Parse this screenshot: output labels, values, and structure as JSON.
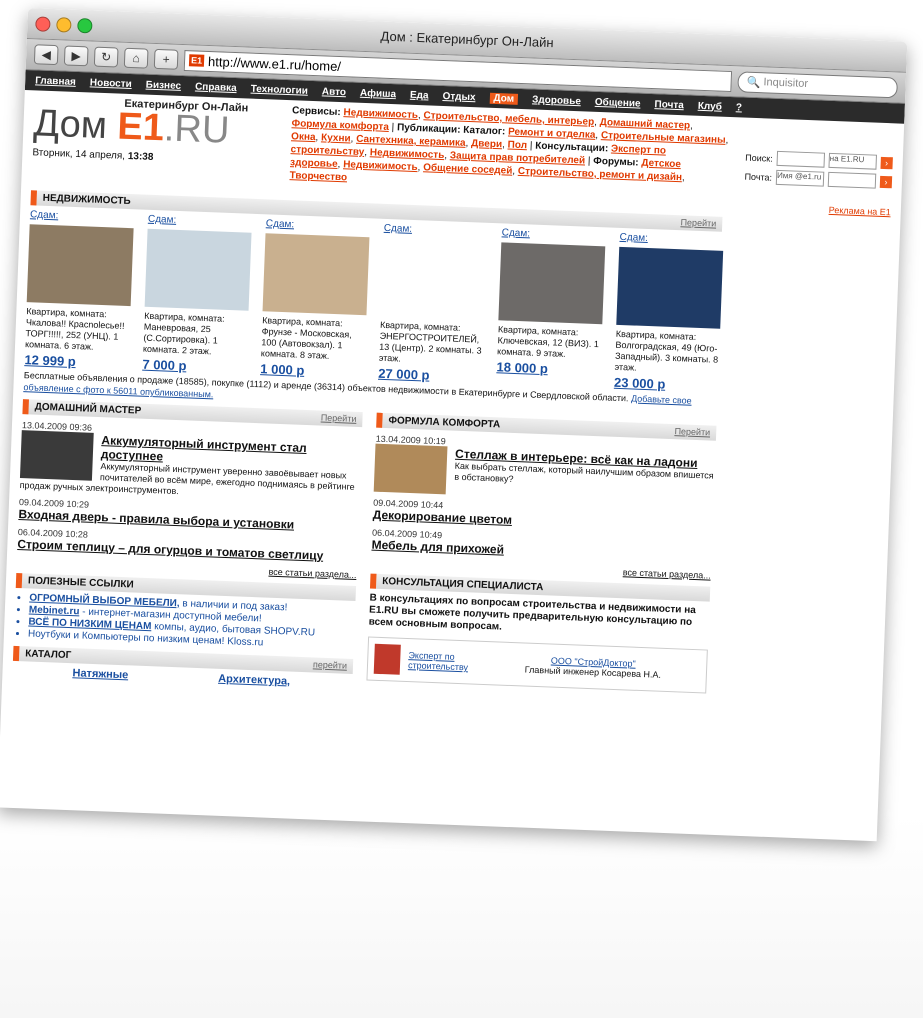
{
  "window": {
    "title": "Дом : Екатеринбург Он-Лайн"
  },
  "toolbar": {
    "url": "http://www.e1.ru/home/",
    "favicon_text": "E1",
    "search_placeholder": "Inquisitor"
  },
  "nav": [
    "Главная",
    "Новости",
    "Бизнес",
    "Справка",
    "Технологии",
    "Авто",
    "Афиша",
    "Еда",
    "Отдых",
    "Дом",
    "Здоровье",
    "Общение",
    "Почта",
    "Клуб"
  ],
  "nav_active": "Дом",
  "nav_extra": "?",
  "logo": {
    "subtitle": "Екатеринбург Он-Лайн",
    "dom": "Дом",
    "e1": "E1",
    "ru": ".RU"
  },
  "services": {
    "label": "Сервисы:",
    "items": [
      "Недвижимость",
      "Строительство, мебель, интерьер",
      "Домашний мастер",
      "Формула комфорта"
    ],
    "pub_label": "Публикации:",
    "catalog_label": "Каталог:",
    "catalog_items": [
      "Ремонт и отделка",
      "Строительные магазины",
      "Окна",
      "Кухни",
      "Сантехника, керамика",
      "Двери",
      "Пол"
    ],
    "consult_label": "Консультации:",
    "consult_items": [
      "Эксперт по строительству",
      "Недвижимость",
      "Защита прав потребителей"
    ],
    "forum_label": "Форумы:",
    "forum_items": [
      "Детское здоровье",
      "Недвижимость",
      "Общение соседей",
      "Строительство, ремонт и дизайн",
      "Творчество"
    ]
  },
  "search": {
    "label": "Поиск:",
    "select": "на E1.RU",
    "mail_label": "Почта:",
    "mail_placeholder": "Имя @e1.ru",
    "ad": "Реклама на E1"
  },
  "date": {
    "text": "Вторник, 14 апреля,",
    "time": "13:38"
  },
  "realty": {
    "header": "НЕДВИЖИМОСТЬ",
    "more": "Перейти",
    "cards": [
      {
        "tag": "Сдам:",
        "desc": "Квартира, комната: Чкалова!! Красnolесье!! ТОРГ!!!!!, 252 (УНЦ). 1 комната. 6 этаж.",
        "price": "12 999 р"
      },
      {
        "tag": "Сдам:",
        "desc": "Квартира, комната: Маневровая, 25 (С.Сортировка). 1 комната. 2 этаж.",
        "price": "7 000 р"
      },
      {
        "tag": "Сдам:",
        "desc": "Квартира, комната: Фрунзе - Московская, 100 (Автовокзал). 1 комната. 8 этаж.",
        "price": "1 000 р"
      },
      {
        "tag": "Сдам:",
        "desc": "Квартира, комната: ЭНЕРГОСТРОИТЕЛЕЙ, 13 (Центр). 2 комнаты. 3 этаж.",
        "price": "27 000 р"
      },
      {
        "tag": "Сдам:",
        "desc": "Квартира, комната: Ключевская, 12 (ВИЗ). 1 комната. 9 этаж.",
        "price": "18 000 р"
      },
      {
        "tag": "Сдам:",
        "desc": "Квартира, комната: Волгоградская, 49 (Юго-Западный). 3 комнаты. 8 этаж.",
        "price": "23 000 р"
      }
    ],
    "note": "Бесплатные объявления о продаже (18585), покупке (1112) и аренде (36314) объектов недвижимости в Екатеринбурге и Свердловской области.",
    "note_link": "Добавьте свое объявление с фото к 56011 опубликованным."
  },
  "master": {
    "header": "ДОМАШНИЙ МАСТЕР",
    "more": "Перейти",
    "articles": [
      {
        "date": "13.04.2009 09:36",
        "title": "Аккумуляторный инструмент стал доступнее",
        "text": "Аккумуляторный инструмент уверенно завоёвывает новых почитателей во всём мире, ежегодно поднимаясь в рейтинге продаж ручных электроинструментов."
      },
      {
        "date": "09.04.2009 10:29",
        "title": "Входная дверь - правила выбора и установки",
        "text": ""
      },
      {
        "date": "06.04.2009 10:28",
        "title": "Строим теплицу – для огурцов и томатов светлицу",
        "text": ""
      }
    ],
    "all": "все статьи раздела..."
  },
  "comfort": {
    "header": "ФОРМУЛА КОМФОРТА",
    "more": "Перейти",
    "articles": [
      {
        "date": "13.04.2009 10:19",
        "title": "Стеллаж в интерьере: всё как на ладони",
        "text": "Как выбрать стеллаж, который наилучшим образом впишется в обстановку?"
      },
      {
        "date": "09.04.2009 10:44",
        "title": "Декорирование цветом",
        "text": ""
      },
      {
        "date": "06.04.2009 10:49",
        "title": "Мебель для прихожей",
        "text": ""
      }
    ],
    "all": "все статьи раздела..."
  },
  "links": {
    "header": "ПОЛЕЗНЫЕ ССЫЛКИ",
    "items": [
      {
        "bold": "ОГРОМНЫЙ ВЫБОР МЕБЕЛИ,",
        "rest": " в наличии и под заказ!"
      },
      {
        "bold": "Mebinet.ru",
        "rest": " - интернет-магазин доступной мебели!"
      },
      {
        "bold": "ВСЁ ПО НИЗКИМ ЦЕНАМ",
        "rest": " компы, аудио, бытовая SHOPV.RU"
      },
      {
        "bold": "",
        "rest": "Ноутбуки и Компьютеры по низким ценам! Kloss.ru"
      }
    ],
    "more": "перейти"
  },
  "catalog": {
    "header": "КАТАЛОГ",
    "items": [
      "Натяжные",
      "Архитектура,"
    ]
  },
  "consult": {
    "header": "КОНСУЛЬТАЦИЯ СПЕЦИАЛИСТА",
    "text": "В консультациях по вопросам строительства и недвижимости на E1.RU вы сможете получить предварительную консультацию по всем основным вопросам.",
    "expert": "Эксперт по строительству",
    "company": "ООО \"СтройДоктор\"",
    "person": "Главный инженер Косарева Н.А."
  },
  "colors": {
    "accent": "#ef5a1a",
    "link": "#1a4fa0",
    "nav_bg": "#2b2b2b"
  }
}
